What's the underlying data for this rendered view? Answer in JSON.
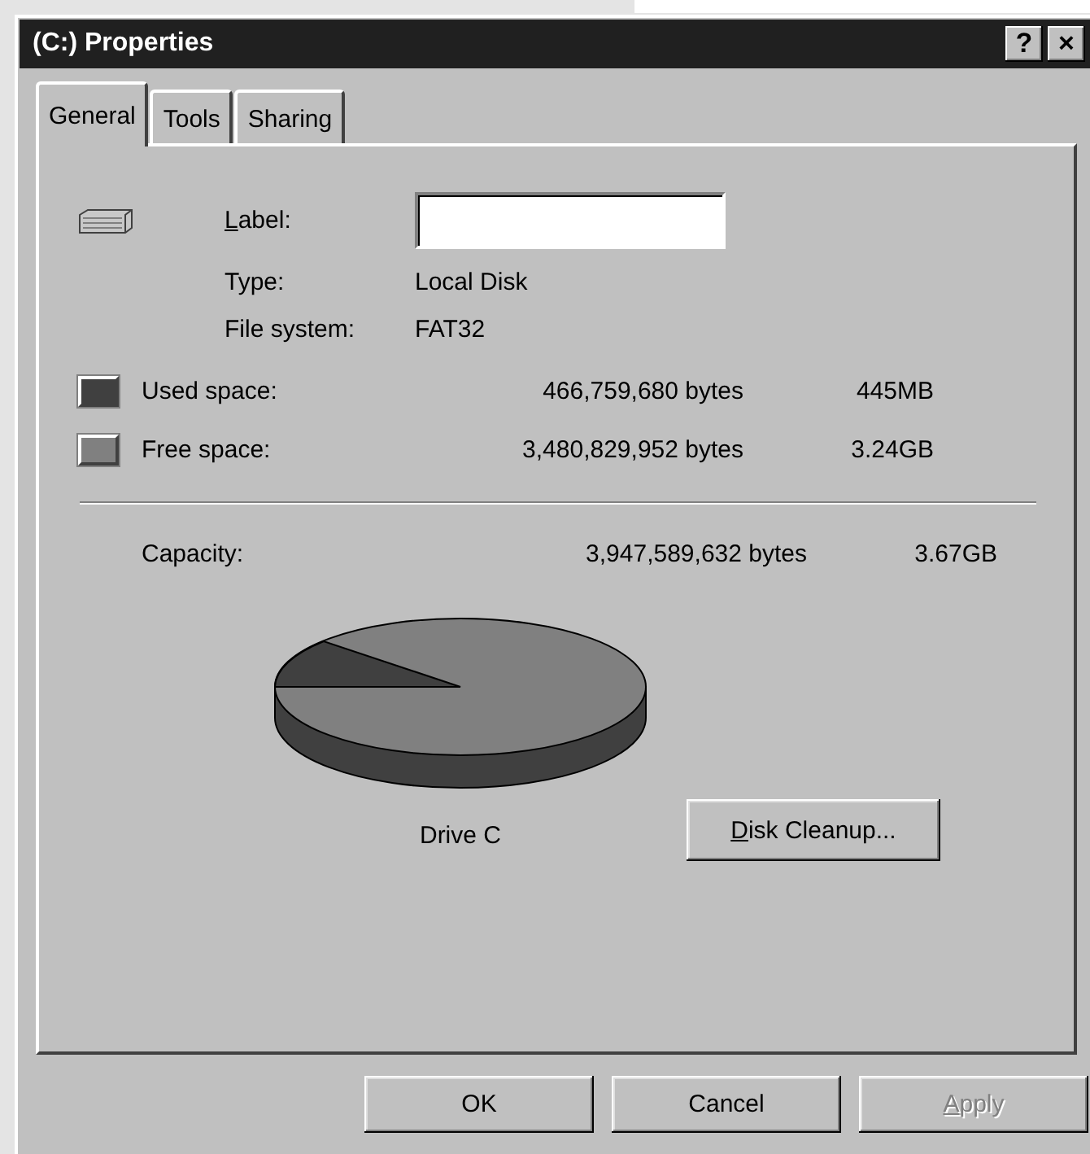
{
  "window": {
    "title": "(C:) Properties",
    "title_buttons": [
      "?",
      "×"
    ]
  },
  "tabs": [
    {
      "label": "General",
      "selected": true
    },
    {
      "label": "Tools",
      "selected": false
    },
    {
      "label": "Sharing",
      "selected": false
    }
  ],
  "label_field": {
    "label": "Label:",
    "mnemonic": true
  },
  "info": [
    {
      "label": "Type:",
      "value": "Local Disk"
    },
    {
      "label": "File system:",
      "value": "FAT32"
    }
  ],
  "space": [
    {
      "label": "Used space:",
      "bytes": "466,759,680 bytes",
      "size": "445MB",
      "color": "#404040"
    },
    {
      "label": "Free space:",
      "bytes": "3,480,829,952 bytes",
      "size": "3.24GB",
      "color": "#808080"
    }
  ],
  "capacity": {
    "label": "Capacity:",
    "bytes": "3,947,589,632 bytes",
    "size": "3.67GB"
  },
  "drive_caption": "Drive C",
  "cleanup_button": {
    "label": "Disk Cleanup...",
    "mnemonic": true
  },
  "buttons": [
    {
      "label": "OK",
      "disabled": false,
      "mnemonic": false
    },
    {
      "label": "Cancel",
      "disabled": false,
      "mnemonic": false
    },
    {
      "label": "Apply",
      "disabled": true,
      "mnemonic": true
    }
  ]
}
